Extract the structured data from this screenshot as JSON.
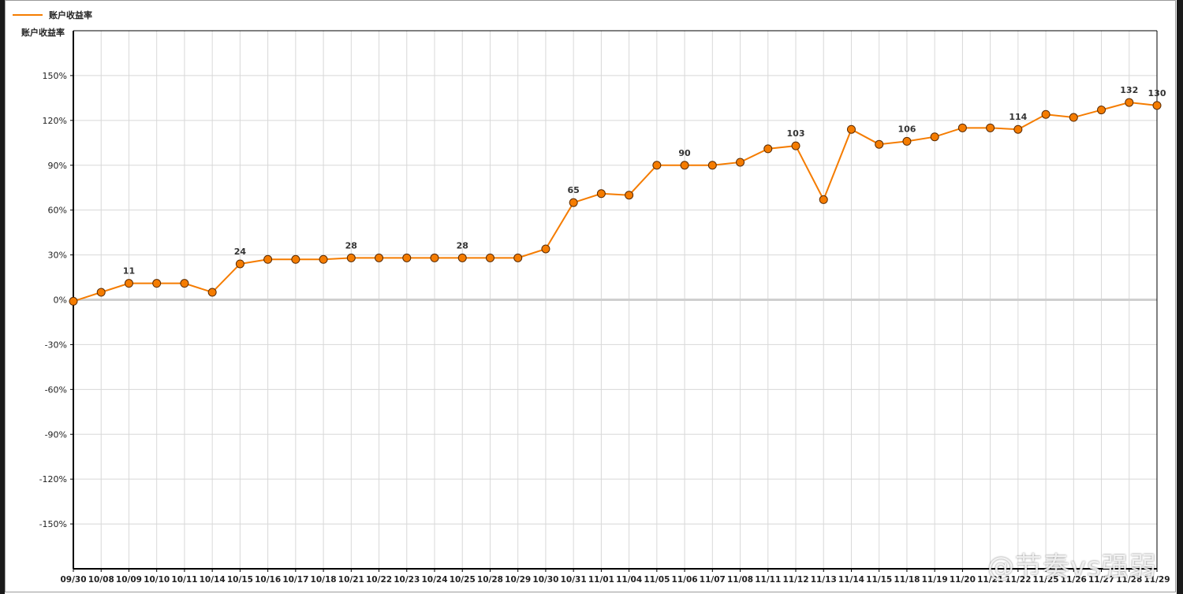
{
  "chart_data": {
    "type": "line",
    "legend": "账户收益率",
    "ylabel": "账户收益率",
    "ylim": [
      -180,
      180
    ],
    "y_ticks": [
      150,
      120,
      90,
      60,
      30,
      0,
      -30,
      -60,
      -90,
      -120,
      -150
    ],
    "y_tick_labels": [
      "150%",
      "120%",
      "90%",
      "60%",
      "30%",
      "0%",
      "-30%",
      "-60%",
      "-90%",
      "-120%",
      "-150%"
    ],
    "categories": [
      "09/30",
      "10/08",
      "10/09",
      "10/10",
      "10/11",
      "10/14",
      "10/15",
      "10/16",
      "10/17",
      "10/18",
      "10/21",
      "10/22",
      "10/23",
      "10/24",
      "10/25",
      "10/28",
      "10/29",
      "10/30",
      "10/31",
      "11/01",
      "11/04",
      "11/05",
      "11/06",
      "11/07",
      "11/08",
      "11/11",
      "11/12",
      "11/13",
      "11/14",
      "11/15",
      "11/18",
      "11/19",
      "11/20",
      "11/21",
      "11/22",
      "11/25",
      "11/26",
      "11/27",
      "11/28",
      "11/29"
    ],
    "series": [
      {
        "name": "账户收益率",
        "color": "#f57c00",
        "values": [
          -1,
          5,
          11,
          11,
          11,
          5,
          24,
          27,
          27,
          27,
          28,
          28,
          28,
          28,
          28,
          28,
          28,
          34,
          65,
          71,
          70,
          90,
          90,
          90,
          92,
          101,
          103,
          67,
          114,
          104,
          106,
          109,
          115,
          115,
          114,
          124,
          122,
          127,
          132,
          130
        ]
      }
    ],
    "data_labels": [
      {
        "index": 2,
        "text": "11"
      },
      {
        "index": 6,
        "text": "24"
      },
      {
        "index": 10,
        "text": "28"
      },
      {
        "index": 14,
        "text": "28"
      },
      {
        "index": 18,
        "text": "65"
      },
      {
        "index": 22,
        "text": "90"
      },
      {
        "index": 26,
        "text": "103"
      },
      {
        "index": 30,
        "text": "106"
      },
      {
        "index": 34,
        "text": "114"
      },
      {
        "index": 38,
        "text": "132"
      },
      {
        "index": 39,
        "text": "130"
      }
    ],
    "grid": true
  },
  "watermark": "@节奏vs强弱",
  "colors": {
    "line": "#f57c00",
    "marker_fill": "#f57c00",
    "marker_stroke": "#5a2b00",
    "grid": "#d8d8d8",
    "zero_line": "#cfcfcf",
    "axis": "#000000"
  }
}
